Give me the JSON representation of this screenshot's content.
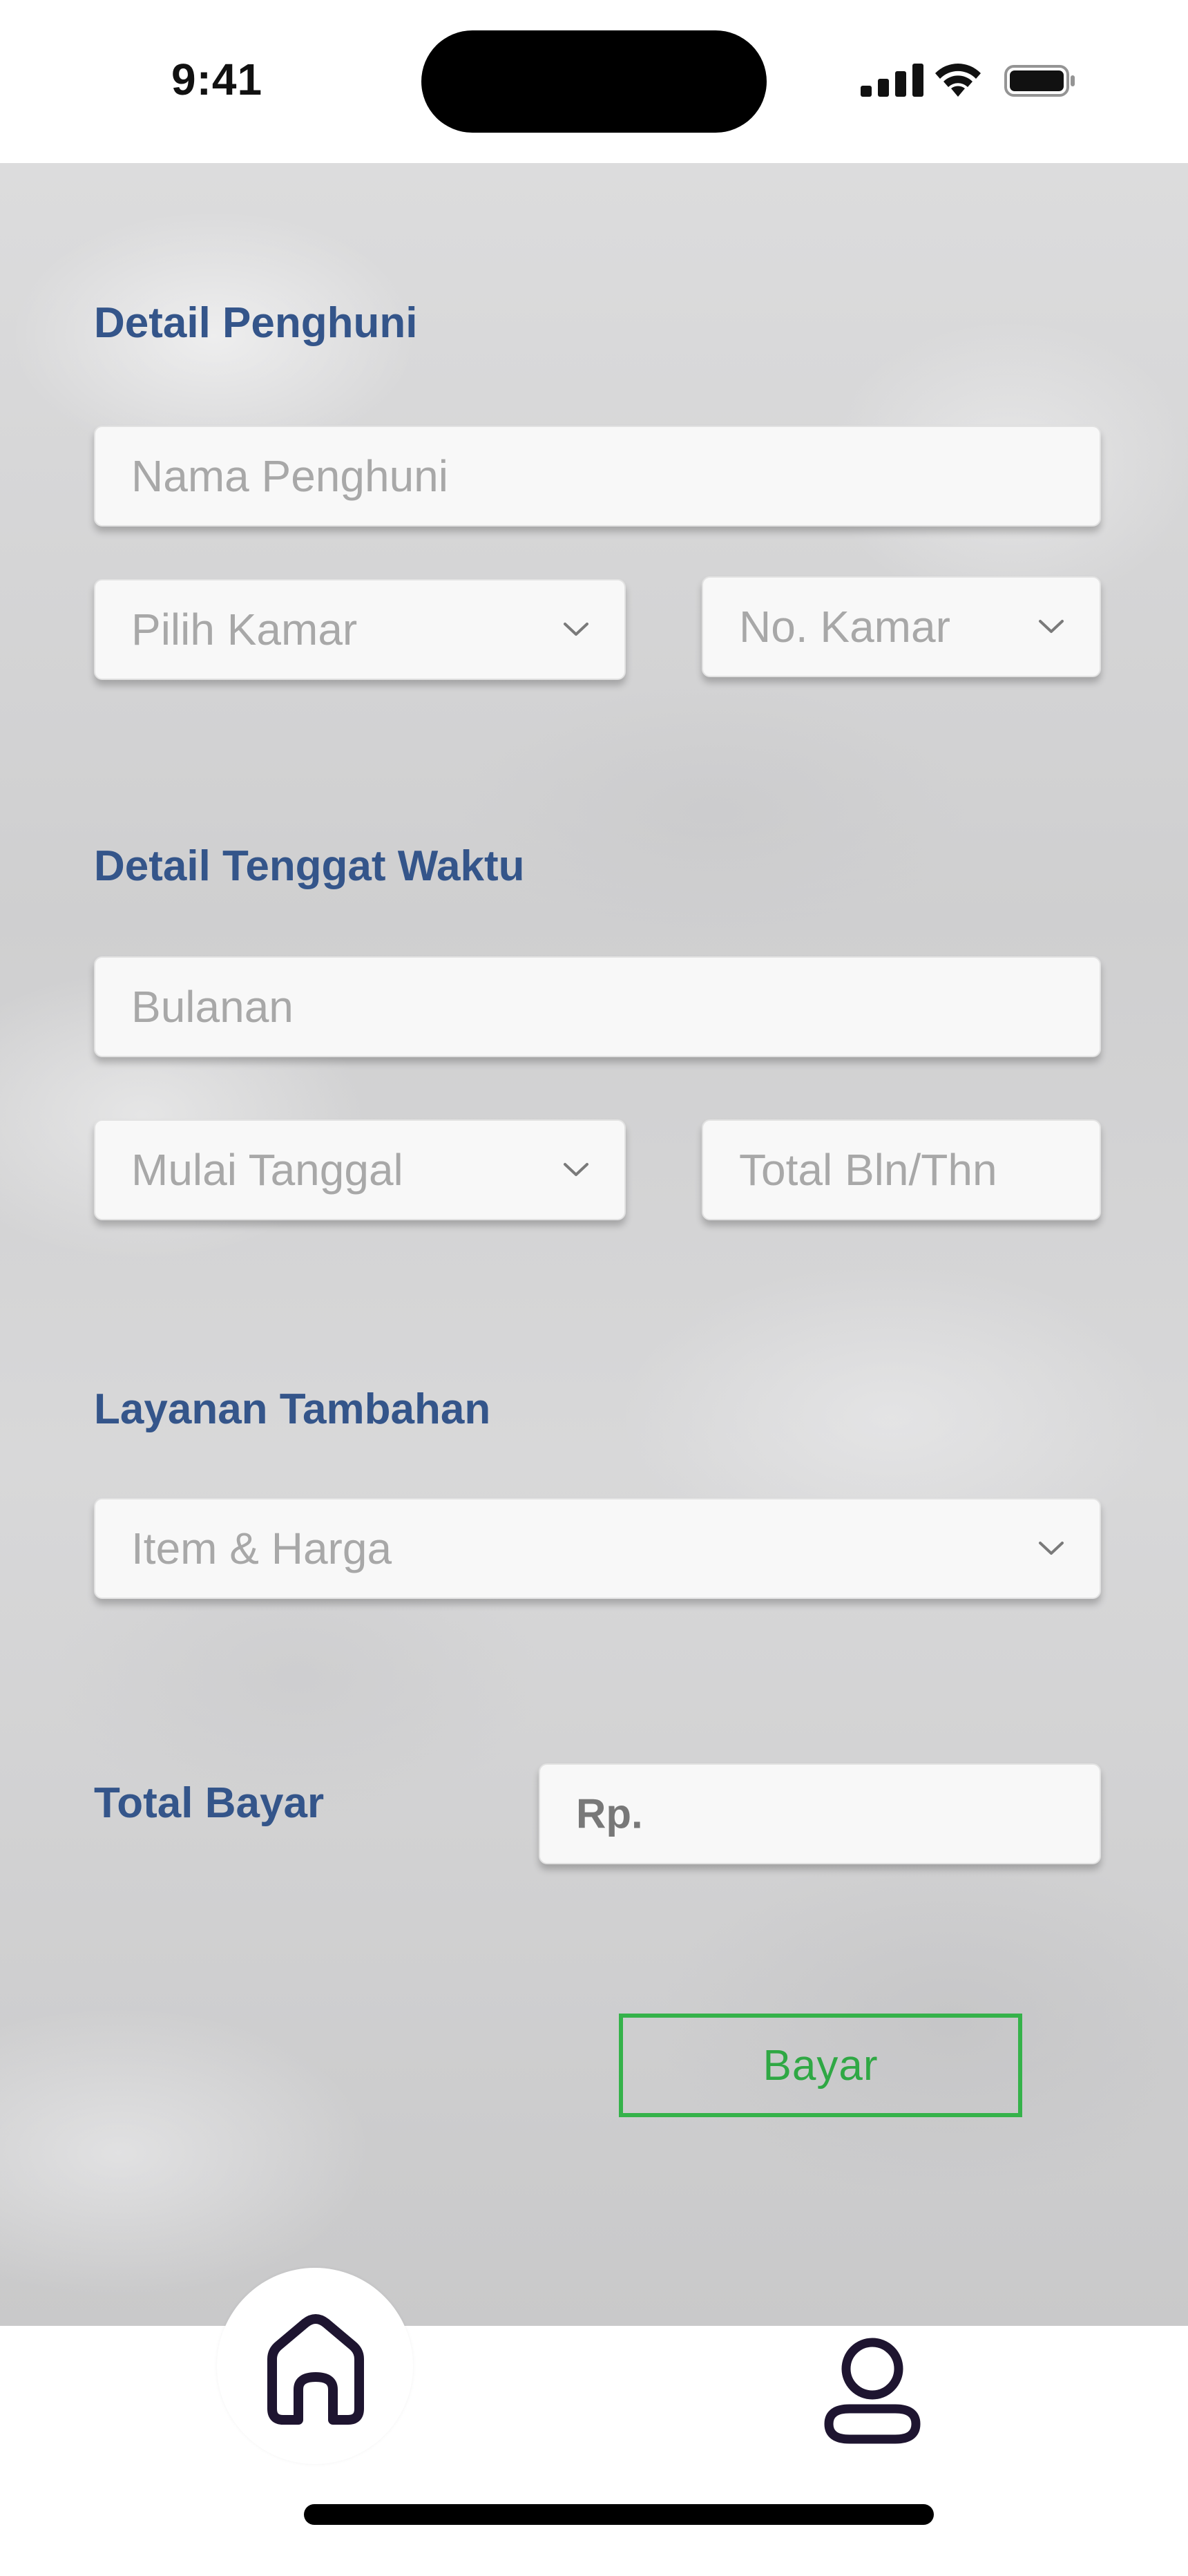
{
  "status_bar": {
    "time": "9:41",
    "icons": [
      "cellular-signal-icon",
      "wifi-icon",
      "battery-icon"
    ]
  },
  "form": {
    "resident_section": {
      "title": "Detail Penghuni",
      "name_placeholder": "Nama Penghuni",
      "room_select_placeholder": "Pilih Kamar",
      "room_number_placeholder": "No. Kamar"
    },
    "due_section": {
      "title": "Detail Tenggat Waktu",
      "period_placeholder": "Bulanan",
      "start_date_placeholder": "Mulai Tanggal",
      "total_period_placeholder": "Total Bln/Thn"
    },
    "addon_section": {
      "title": "Layanan Tambahan",
      "item_price_placeholder": "Item & Harga"
    },
    "total_section": {
      "label": "Total Bayar",
      "amount_prefix": "Rp."
    },
    "pay_button_label": "Bayar"
  },
  "bottom_nav": {
    "items": [
      "home-icon",
      "profile-icon"
    ]
  },
  "colors": {
    "section_title": "#34558a",
    "pay_button": "#35b24a",
    "placeholder_text": "#a8a8a8",
    "nav_icon": "#1e1530"
  }
}
